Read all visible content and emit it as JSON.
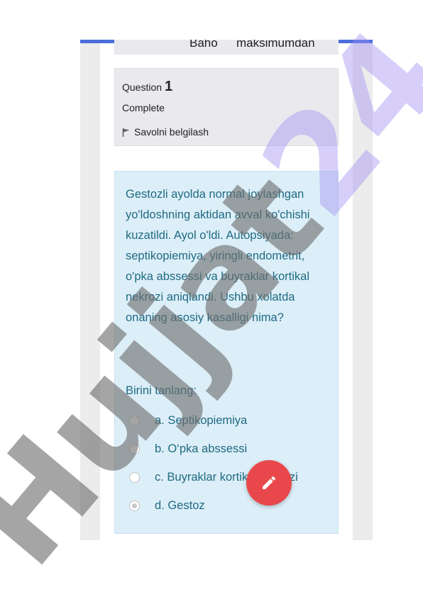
{
  "header": {
    "grade_label": "Baho",
    "grade_value": "maksimumdan"
  },
  "question_info": {
    "question_word": "Question",
    "question_number": "1",
    "status": "Complete",
    "flag_label": "Savolni belgilash"
  },
  "question": {
    "text": "Gestozli ayolda normal joylashgan yo'ldoshning aktidan avval ko'chishi kuzatildi. Ayol o'ldi. Autopsiyada: septikopiemiya, yiringli endometrit, o'pka abssessi va buyraklar kortikal nekrozi aniqlandi. Ushbu xolatda onaning asosiy kasalligi nima?",
    "prompt": "Birini tanlang:",
    "options": [
      {
        "label": "a. Septikopiemiya",
        "selected": false
      },
      {
        "label": "b. O‘pka abssessi",
        "selected": false
      },
      {
        "label": "c. Buyraklar kortikal nekrozi",
        "selected": false
      },
      {
        "label": "d. Gestoz",
        "selected": true
      }
    ]
  },
  "fab": {
    "icon": "pencil-icon",
    "color": "#e8484b"
  },
  "watermark": {
    "part1": "Hujjat",
    "part2": "24"
  },
  "colors": {
    "accent": "#4a6fdc",
    "question_bg": "#dceef8",
    "question_text": "#1f6a82"
  }
}
